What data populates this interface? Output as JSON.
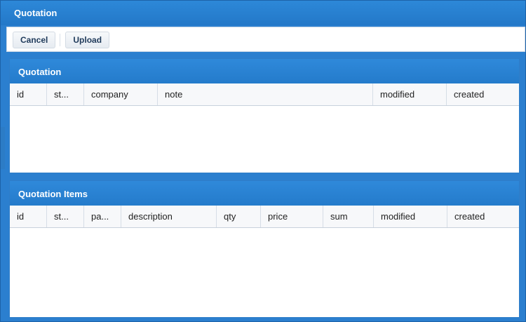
{
  "window": {
    "title": "Quotation"
  },
  "toolbar": {
    "cancel_label": "Cancel",
    "upload_label": "Upload"
  },
  "quotation_panel": {
    "title": "Quotation",
    "columns": [
      "id",
      "st...",
      "company",
      "note",
      "modified",
      "created"
    ]
  },
  "items_panel": {
    "title": "Quotation Items",
    "columns": [
      "id",
      "st...",
      "pa...",
      "description",
      "qty",
      "price",
      "sum",
      "modified",
      "created"
    ]
  },
  "colors": {
    "header_blue": "#2378c8",
    "border_blue": "#1d62a8",
    "grid_header_bg": "#f7f8fa"
  }
}
